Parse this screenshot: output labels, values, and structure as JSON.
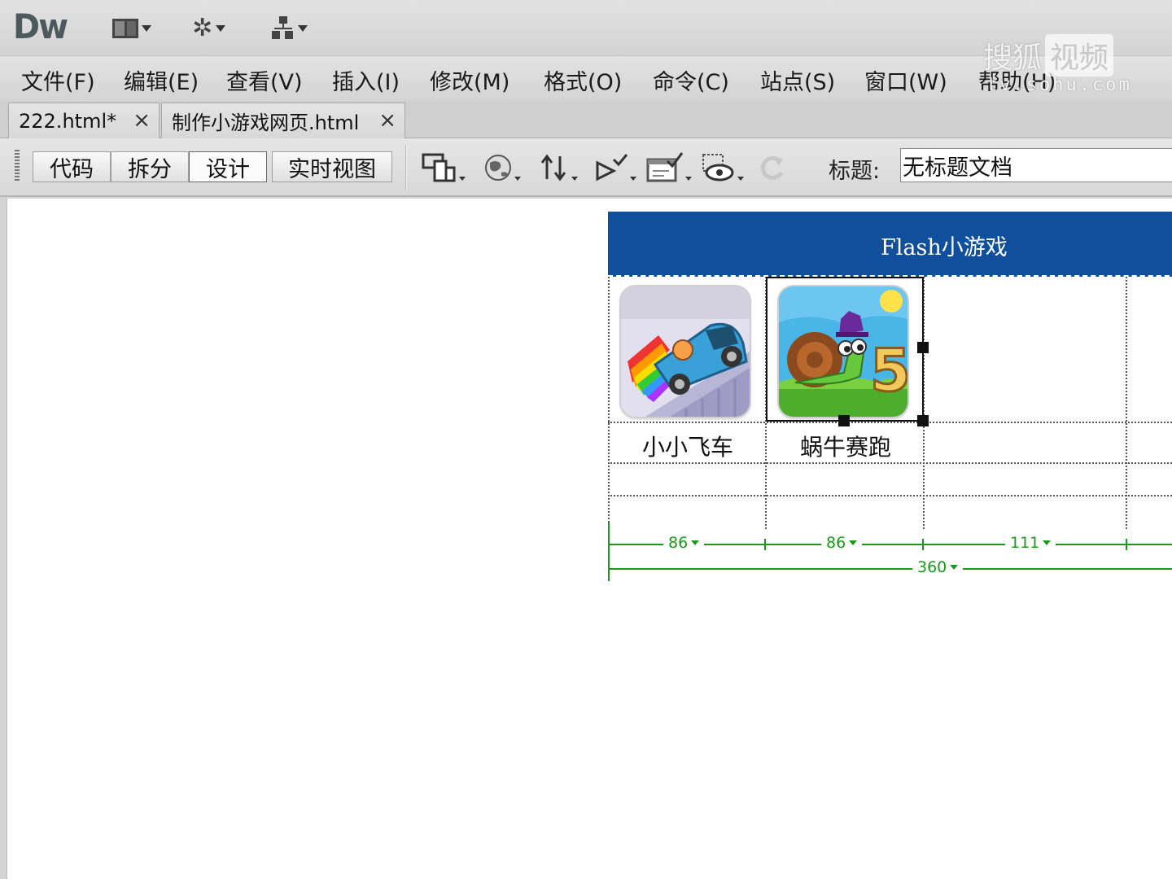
{
  "app": {
    "logo": "Dw",
    "watermark": {
      "top_chars": "搜狐",
      "top_box": "视频",
      "bottom": "tv.sohu.com"
    }
  },
  "menu": [
    "文件(F)",
    "编辑(E)",
    "查看(V)",
    "插入(I)",
    "修改(M)",
    "格式(O)",
    "命令(C)",
    "站点(S)",
    "窗口(W)",
    "帮助(H)"
  ],
  "tabs": [
    {
      "label": "222.html*",
      "close": "×"
    },
    {
      "label": "制作小游戏网页.html",
      "close": "×"
    }
  ],
  "toolbar": {
    "views": [
      "代码",
      "拆分",
      "设计",
      "实时视图"
    ],
    "active_view": "设计",
    "title_label": "标题:",
    "title_value": "无标题文档"
  },
  "page": {
    "banner_title": "Flash小游戏",
    "banner_color": "#0f4f9c",
    "games": [
      {
        "name": "小小飞车",
        "icon": "rainbow-van-icon"
      },
      {
        "name": "蜗牛赛跑",
        "icon": "snail-bob-5-icon"
      }
    ],
    "column_widths": [
      "86",
      "86",
      "111"
    ],
    "table_width": "360"
  },
  "colors": {
    "ruler": "#1a9a1a",
    "chrome": "#d4d4d4"
  }
}
